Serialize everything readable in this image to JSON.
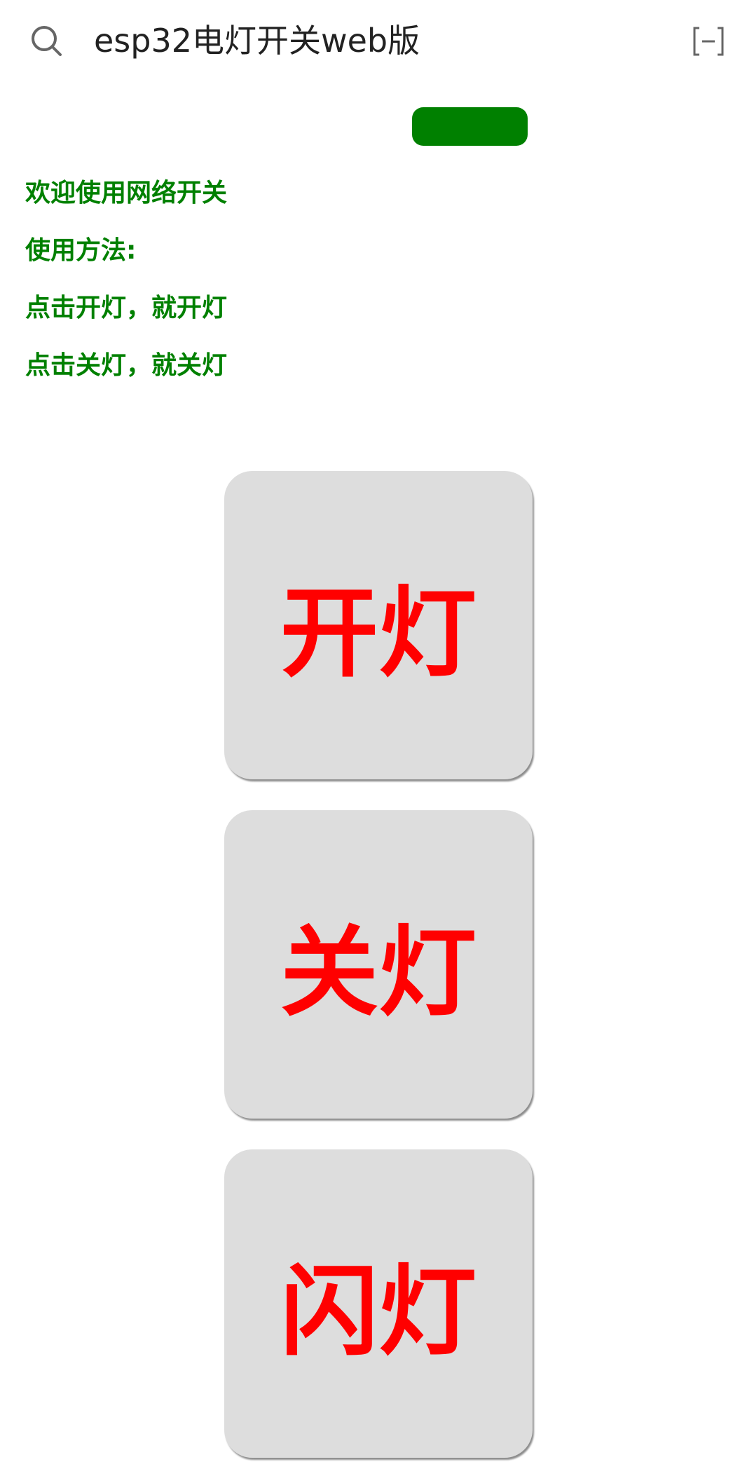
{
  "header": {
    "title": "esp32电灯开关web版",
    "search_icon": "search-icon",
    "minimize_icon": "minimize-icon"
  },
  "status_pill": {
    "color": "#008000"
  },
  "intro": {
    "lines": [
      "欢迎使用网络开关",
      "使用方法:",
      "点击开灯，就开灯",
      "点击关灯，就关灯"
    ],
    "color": "#008000"
  },
  "buttons": {
    "on_label": "开灯",
    "off_label": "关灯",
    "flash_label": "闪灯",
    "text_color": "#ff0000",
    "background": "#dddddd"
  }
}
